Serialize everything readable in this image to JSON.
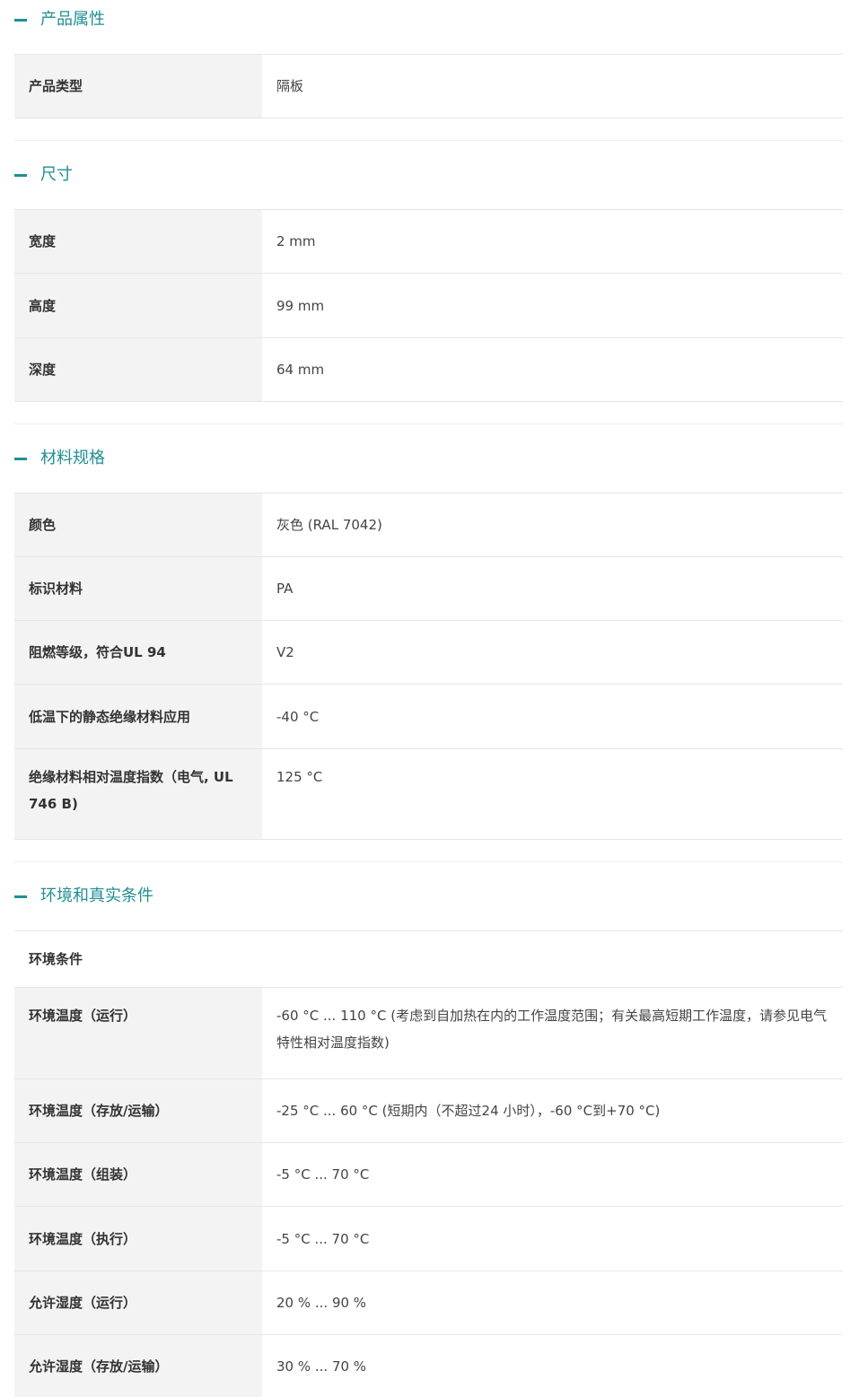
{
  "sections": [
    {
      "title": "产品属性",
      "rows": [
        {
          "k": "产品类型",
          "v": "隔板"
        }
      ]
    },
    {
      "title": "尺寸",
      "rows": [
        {
          "k": "宽度",
          "v": "2 mm"
        },
        {
          "k": "高度",
          "v": "99 mm"
        },
        {
          "k": "深度",
          "v": "64 mm"
        }
      ]
    },
    {
      "title": "材料规格",
      "rows": [
        {
          "k": "颜色",
          "v": "灰色 (RAL 7042)"
        },
        {
          "k": "标识材料",
          "v": "PA"
        },
        {
          "k": "阻燃等级，符合UL 94",
          "v": "V2"
        },
        {
          "k": "低温下的静态绝缘材料应用",
          "v": "-40 °C"
        },
        {
          "k": "绝缘材料相对温度指数（电气, UL 746 B)",
          "v": "125 °C"
        }
      ]
    },
    {
      "title": "环境和真实条件",
      "subheading": "环境条件",
      "rows": [
        {
          "k": "环境温度（运行）",
          "v": "-60 °C ... 110 °C (考虑到自加热在内的工作温度范围；有关最高短期工作温度，请参见电气特性相对温度指数)"
        },
        {
          "k": "环境温度（存放/运输）",
          "v": "-25 °C ... 60 °C (短期内（不超过24  小时），-60 °C到+70 °C)"
        },
        {
          "k": "环境温度（组装）",
          "v": "-5 °C ... 70 °C"
        },
        {
          "k": "环境温度（执行）",
          "v": "-5 °C ... 70 °C"
        },
        {
          "k": "允许湿度（运行）",
          "v": "20 % ... 90 %"
        },
        {
          "k": "允许湿度（存放/运输）",
          "v": "30 % ... 70 %"
        }
      ]
    }
  ]
}
